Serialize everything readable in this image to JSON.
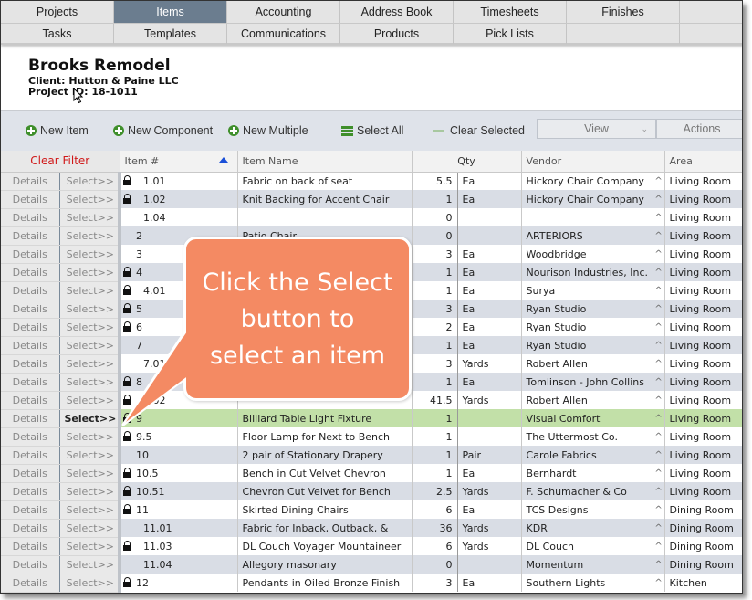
{
  "nav": {
    "row1": [
      "Projects",
      "Items",
      "Accounting",
      "Address Book",
      "Timesheets",
      "Finishes"
    ],
    "row2": [
      "Tasks",
      "Templates",
      "Communications",
      "Products",
      "Pick Lists"
    ],
    "active": "Items"
  },
  "project": {
    "title": "Brooks Remodel",
    "client": "Client: Hutton & Paine LLC",
    "project_id": "Project ID: 18-1011"
  },
  "toolbar": {
    "new_item": "New Item",
    "new_component": "New Component",
    "new_multiple": "New Multiple",
    "select_all": "Select All",
    "clear_selected": "Clear Selected",
    "view": "View",
    "actions": "Actions"
  },
  "grid": {
    "clear_filter": "Clear Filter",
    "headers": {
      "item_num": "Item #",
      "item_name": "Item Name",
      "qty": "Qty",
      "vendor": "Vendor",
      "area": "Area"
    },
    "details_label": "Details",
    "select_label": "Select>>",
    "caret": "^",
    "rows": [
      {
        "num": "1.01",
        "locked": true,
        "sub": true,
        "name": "Fabric on back of seat",
        "qty": "5.5",
        "unit": "Ea",
        "vendor": "Hickory Chair Company",
        "area": "Living Room"
      },
      {
        "num": "1.02",
        "locked": true,
        "sub": true,
        "name": "Knit Backing for Accent Chair",
        "qty": "1",
        "unit": "Ea",
        "vendor": "Hickory Chair Company",
        "area": "Living Room"
      },
      {
        "num": "1.04",
        "locked": false,
        "sub": true,
        "name": "",
        "qty": "0",
        "unit": "",
        "vendor": "",
        "area": "Living Room"
      },
      {
        "num": "2",
        "locked": false,
        "sub": false,
        "name": "Patio Chair",
        "qty": "0",
        "unit": "",
        "vendor": "ARTERIORS",
        "area": "Living Room"
      },
      {
        "num": "3",
        "locked": false,
        "sub": false,
        "name": "",
        "qty": "3",
        "unit": "Ea",
        "vendor": "Woodbridge",
        "area": "Living Room"
      },
      {
        "num": "4",
        "locked": true,
        "sub": false,
        "name": "",
        "qty": "1",
        "unit": "Ea",
        "vendor": "Nourison Industries, Inc.",
        "area": "Living Room"
      },
      {
        "num": "4.01",
        "locked": true,
        "sub": true,
        "name": "",
        "qty": "1",
        "unit": "Ea",
        "vendor": "Surya",
        "area": "Living Room"
      },
      {
        "num": "5",
        "locked": true,
        "sub": false,
        "name": "",
        "qty": "3",
        "unit": "Ea",
        "vendor": "Ryan Studio",
        "area": "Living Room"
      },
      {
        "num": "6",
        "locked": true,
        "sub": false,
        "name": "",
        "qty": "2",
        "unit": "Ea",
        "vendor": "Ryan Studio",
        "area": "Living Room"
      },
      {
        "num": "7",
        "locked": false,
        "sub": false,
        "name": "",
        "qty": "1",
        "unit": "Ea",
        "vendor": "Ryan Studio",
        "area": "Living Room"
      },
      {
        "num": "7.01",
        "locked": false,
        "sub": true,
        "name": "",
        "qty": "3",
        "unit": "Yards",
        "vendor": "Robert Allen",
        "area": "Living Room"
      },
      {
        "num": "8",
        "locked": true,
        "sub": false,
        "name": "",
        "qty": "1",
        "unit": "Ea",
        "vendor": "Tomlinson - John Collins",
        "area": "Living Room"
      },
      {
        "num": "8.02",
        "locked": true,
        "sub": true,
        "name": "",
        "qty": "41.5",
        "unit": "Yards",
        "vendor": "Robert Allen",
        "area": "Living Room"
      },
      {
        "num": "9",
        "locked": true,
        "sub": false,
        "selected": true,
        "name": "Billiard Table Light Fixture",
        "qty": "1",
        "unit": "",
        "vendor": "Visual Comfort",
        "area": "Living Room"
      },
      {
        "num": "9.5",
        "locked": true,
        "sub": false,
        "name": "Floor Lamp for Next to Bench",
        "qty": "1",
        "unit": "",
        "vendor": "The Uttermost Co.",
        "area": "Living Room"
      },
      {
        "num": "10",
        "locked": false,
        "sub": false,
        "name": "2 pair of Stationary Drapery",
        "qty": "1",
        "unit": "Pair",
        "vendor": "Carole Fabrics",
        "area": "Living Room"
      },
      {
        "num": "10.5",
        "locked": true,
        "sub": false,
        "name": "Bench in Cut Velvet Chevron",
        "qty": "1",
        "unit": "Ea",
        "vendor": "Bernhardt",
        "area": "Living Room"
      },
      {
        "num": "10.51",
        "locked": true,
        "sub": false,
        "name": "Chevron Cut Velvet for Bench",
        "qty": "2.5",
        "unit": "Yards",
        "vendor": "F. Schumacher & Co",
        "area": "Living Room"
      },
      {
        "num": "11",
        "locked": true,
        "sub": false,
        "name": "Skirted Dining Chairs",
        "qty": "6",
        "unit": "Ea",
        "vendor": "TCS Designs",
        "area": "Dining Room"
      },
      {
        "num": "11.01",
        "locked": false,
        "sub": true,
        "name": "Fabric for Inback, Outback, &",
        "qty": "36",
        "unit": "Yards",
        "vendor": "KDR",
        "area": "Dining Room"
      },
      {
        "num": "11.03",
        "locked": true,
        "sub": true,
        "name": "DL Couch Voyager Mountaineer",
        "qty": "6",
        "unit": "Yards",
        "vendor": "DL Couch",
        "area": "Dining Room"
      },
      {
        "num": "11.04",
        "locked": false,
        "sub": true,
        "name": "Allegory masonary",
        "qty": "0",
        "unit": "",
        "vendor": "Momentum",
        "area": "Dining Room"
      },
      {
        "num": "12",
        "locked": true,
        "sub": false,
        "name": "Pendants in Oiled Bronze Finish",
        "qty": "3",
        "unit": "Ea",
        "vendor": "Southern Lights",
        "area": "Kitchen"
      }
    ]
  },
  "callout": {
    "lines": [
      "Click the Select",
      "button to",
      "select an item"
    ],
    "color": "#f48a63"
  },
  "colors": {
    "nav_active": "#6b7d8f",
    "selected_row": "#c2e0a8",
    "alt_row": "#d9dde5",
    "clear_filter": "#d01818",
    "sort_arrow": "#1a4fd8",
    "action_green": "#3f8f2b"
  }
}
